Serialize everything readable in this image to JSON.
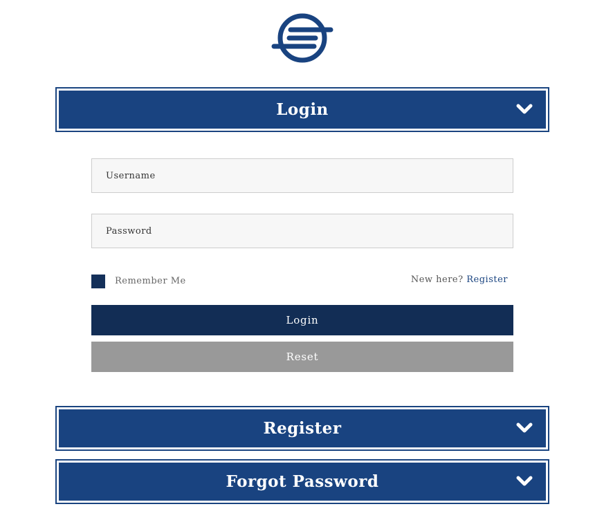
{
  "brand": {
    "logo_icon": "circle-lines-logo-icon",
    "color_primary": "#194380",
    "color_dark": "#122d55",
    "color_reset": "#999999"
  },
  "sections": {
    "login": {
      "title": "Login",
      "icon": "chevron-down-icon",
      "expanded": true
    },
    "register": {
      "title": "Register",
      "icon": "chevron-down-icon",
      "expanded": false
    },
    "forgot": {
      "title": "Forgot Password",
      "icon": "chevron-down-icon",
      "expanded": false
    }
  },
  "form": {
    "username": {
      "placeholder": "Username",
      "value": ""
    },
    "password": {
      "placeholder": "Password",
      "value": ""
    },
    "remember": {
      "label": "Remember Me",
      "checked": false
    },
    "new_here": {
      "text": "New here?",
      "link": "Register"
    },
    "login_button": "Login",
    "reset_button": "Reset"
  }
}
